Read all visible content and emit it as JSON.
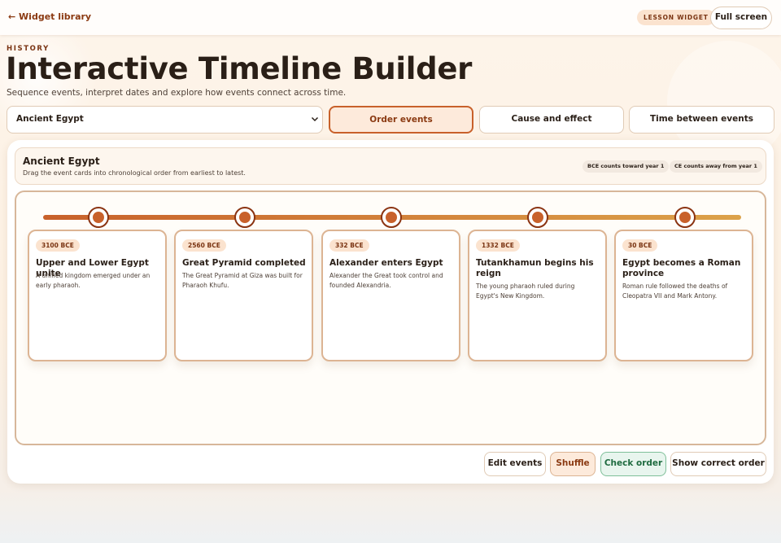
{
  "topbar": {
    "back_label": "← Widget library",
    "badge": "LESSON WIDGET",
    "fullscreen_label": "Full screen"
  },
  "header": {
    "eyebrow": "HISTORY",
    "title": "Interactive Timeline Builder",
    "subtitle": "Sequence events, interpret dates and explore how events connect across time."
  },
  "controls": {
    "topic_select": {
      "value": "Ancient Egypt"
    },
    "modes": [
      {
        "label": "Order events",
        "active": true
      },
      {
        "label": "Cause and effect",
        "active": false
      },
      {
        "label": "Time between events",
        "active": false
      }
    ]
  },
  "info": {
    "title": "Ancient Egypt",
    "description": "Drag the event cards into chronological order from earliest to latest.",
    "chips": [
      "BCE counts toward year 1",
      "CE counts away from year 1"
    ]
  },
  "events": [
    {
      "date": "3100 BCE",
      "title": "Upper and Lower Egypt unite",
      "description": "A unified kingdom emerged under an early pharaoh."
    },
    {
      "date": "2560 BCE",
      "title": "Great Pyramid completed",
      "description": "The Great Pyramid at Giza was built for Pharaoh Khufu."
    },
    {
      "date": "332 BCE",
      "title": "Alexander enters Egypt",
      "description": "Alexander the Great took control and founded Alexandria."
    },
    {
      "date": "1332 BCE",
      "title": "Tutankhamun begins his reign",
      "description": "The young pharaoh ruled during Egypt's New Kingdom."
    },
    {
      "date": "30 BCE",
      "title": "Egypt becomes a Roman province",
      "description": "Roman rule followed the deaths of Cleopatra VII and Mark Antony."
    }
  ],
  "actions": {
    "edit": "Edit events",
    "shuffle": "Shuffle",
    "check": "Check order",
    "show": "Show correct order"
  },
  "colors": {
    "accent": "#c8612b",
    "accent_dark": "#8b3a12",
    "success": "#1f6b40"
  }
}
